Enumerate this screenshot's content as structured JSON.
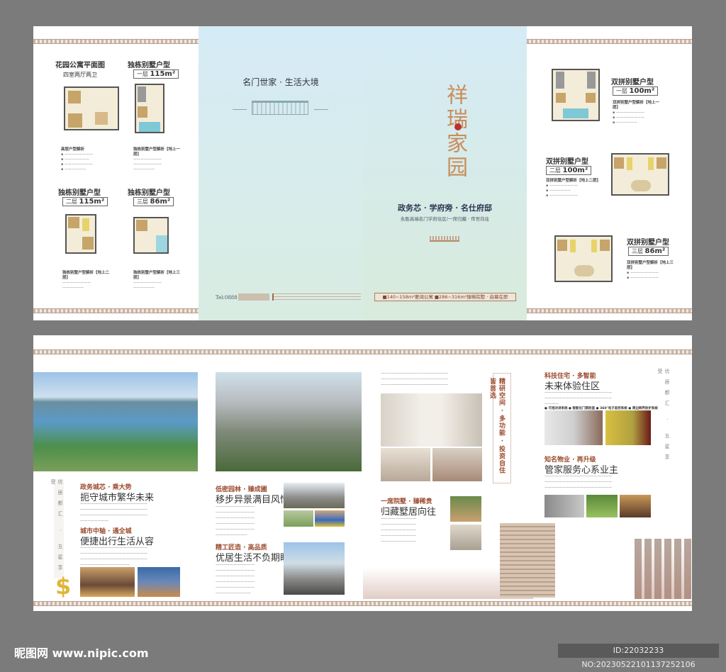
{
  "top": {
    "left_plans": [
      {
        "title": "花园公寓平面图",
        "sub": "四室两厅两卫",
        "desc_title": "高层户型解析"
      },
      {
        "title": "独栋别墅户型",
        "floor": "一层",
        "area": "115m²",
        "desc_title": "独栋别墅户型解析【地上一层】"
      },
      {
        "title": "独栋别墅户型",
        "floor": "二层",
        "area": "115m²",
        "desc_title": "独栋别墅户型解析【地上二层】"
      },
      {
        "title": "独栋别墅户型",
        "floor": "三层",
        "area": "86m²",
        "desc_title": "独栋别墅户型解析【地上三层】"
      }
    ],
    "back_cover": {
      "slogan": "名门世家 · 生活大境",
      "tel": "Tel:0888"
    },
    "front_cover": {
      "logo": "祥瑞家园",
      "headline": "政务芯 · 学府旁 · 名仕府邸",
      "subline": "永胜高端名门学府住区/一席归藏 · 传世向往",
      "banner": "■140~158m²奢阔公寓  ■286~316m²臻稀院墅 · 启幕在即"
    },
    "right_plans": [
      {
        "title": "双拼别墅户型",
        "floor": "一层",
        "area": "100m²",
        "desc_title": "双拼别墅户型解析【地上一层】"
      },
      {
        "title": "双拼别墅户型",
        "floor": "二层",
        "area": "100m²",
        "desc_title": "双拼别墅户型解析【地上二层】"
      },
      {
        "title": "双拼别墅户型",
        "floor": "三层",
        "area": "86m²",
        "desc_title": "双拼别墅户型解析【地上三层】"
      }
    ]
  },
  "bottom": {
    "side_vertical": "优居都汇 · 五星享受",
    "sections": [
      {
        "h1": "政务城芯 · 乘大势",
        "h2": "扼守城市繁华未来"
      },
      {
        "h1": "城市中轴 · 通全城",
        "h2": "便捷出行生活从容"
      },
      {
        "h1": "低密园林 · 臻成圃",
        "h2": "移步异景满目风情"
      },
      {
        "h1": "精工匠造 · 高品质",
        "h2": "优居生活不负期盼"
      },
      {
        "h1": "一席院墅 · 臻稀贵",
        "h2": "归藏墅居向往"
      },
      {
        "h1": "科技住宅 · 多智能",
        "h2": "未来体验住区"
      },
      {
        "h1": "知名物业 · 再升级",
        "h2": "管家服务心系业主"
      }
    ],
    "vertical_banner": "精研空间 · 多功能 · 投资自住皆首选",
    "tech_features": "● 可视对讲系统  ● 智能化门禁防盗  ● 360°电子监控系统  ● 周边网界防护系统"
  },
  "footer": {
    "logo": "昵图网 www.nipic.com",
    "id": "ID:22032233 NO:20230522101137252106"
  }
}
